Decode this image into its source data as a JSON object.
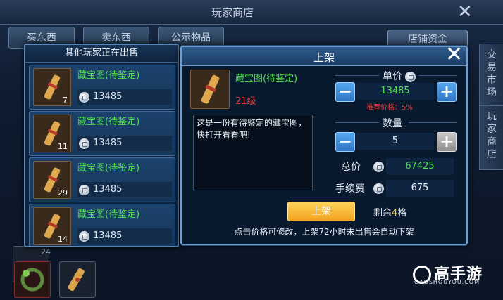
{
  "background": {
    "title": "玩家商店",
    "tabs": [
      "买东西",
      "卖东西",
      "公示物品"
    ],
    "funds_label": "店铺资金",
    "side_tabs": [
      "交易市场",
      "玩家商店"
    ],
    "slot_count": "24"
  },
  "left_panel": {
    "title": "其他玩家正在出售",
    "items": [
      {
        "name": "藏宝图(待鉴定)",
        "count": "7",
        "price": "13485"
      },
      {
        "name": "藏宝图(待鉴定)",
        "count": "11",
        "price": "13485"
      },
      {
        "name": "藏宝图(待鉴定)",
        "count": "29",
        "price": "13485"
      },
      {
        "name": "藏宝图(待鉴定)",
        "count": "14",
        "price": "13485"
      }
    ]
  },
  "dialog": {
    "title": "上架",
    "item_name": "藏宝图(待鉴定)",
    "item_level": "21级",
    "description": "这是一份有待鉴定的藏宝图，快打开看看吧!",
    "unit_price_label": "单价",
    "unit_price": "13485",
    "recommend_label": "推荐价格：5%",
    "quantity_label": "数量",
    "quantity": "5",
    "total_label": "总价",
    "total": "67425",
    "fee_label": "手续费",
    "fee": "675",
    "submit_label": "上架",
    "slots_prefix": "剩余",
    "slots_count": "4",
    "slots_suffix": "格",
    "footer": "点击价格可修改，上架72小时未出售会自动下架"
  },
  "watermark": {
    "brand": "高手游",
    "url": "GAOSHOUYOU.COM"
  },
  "colors": {
    "item_name": "#4ee04e",
    "level": "#e23b3b",
    "button_gold": "#f0a21c",
    "button_blue": "#2f74c2"
  },
  "icons": [
    "close-icon",
    "coin-icon",
    "minus-icon",
    "plus-icon",
    "treasure-map-icon"
  ]
}
